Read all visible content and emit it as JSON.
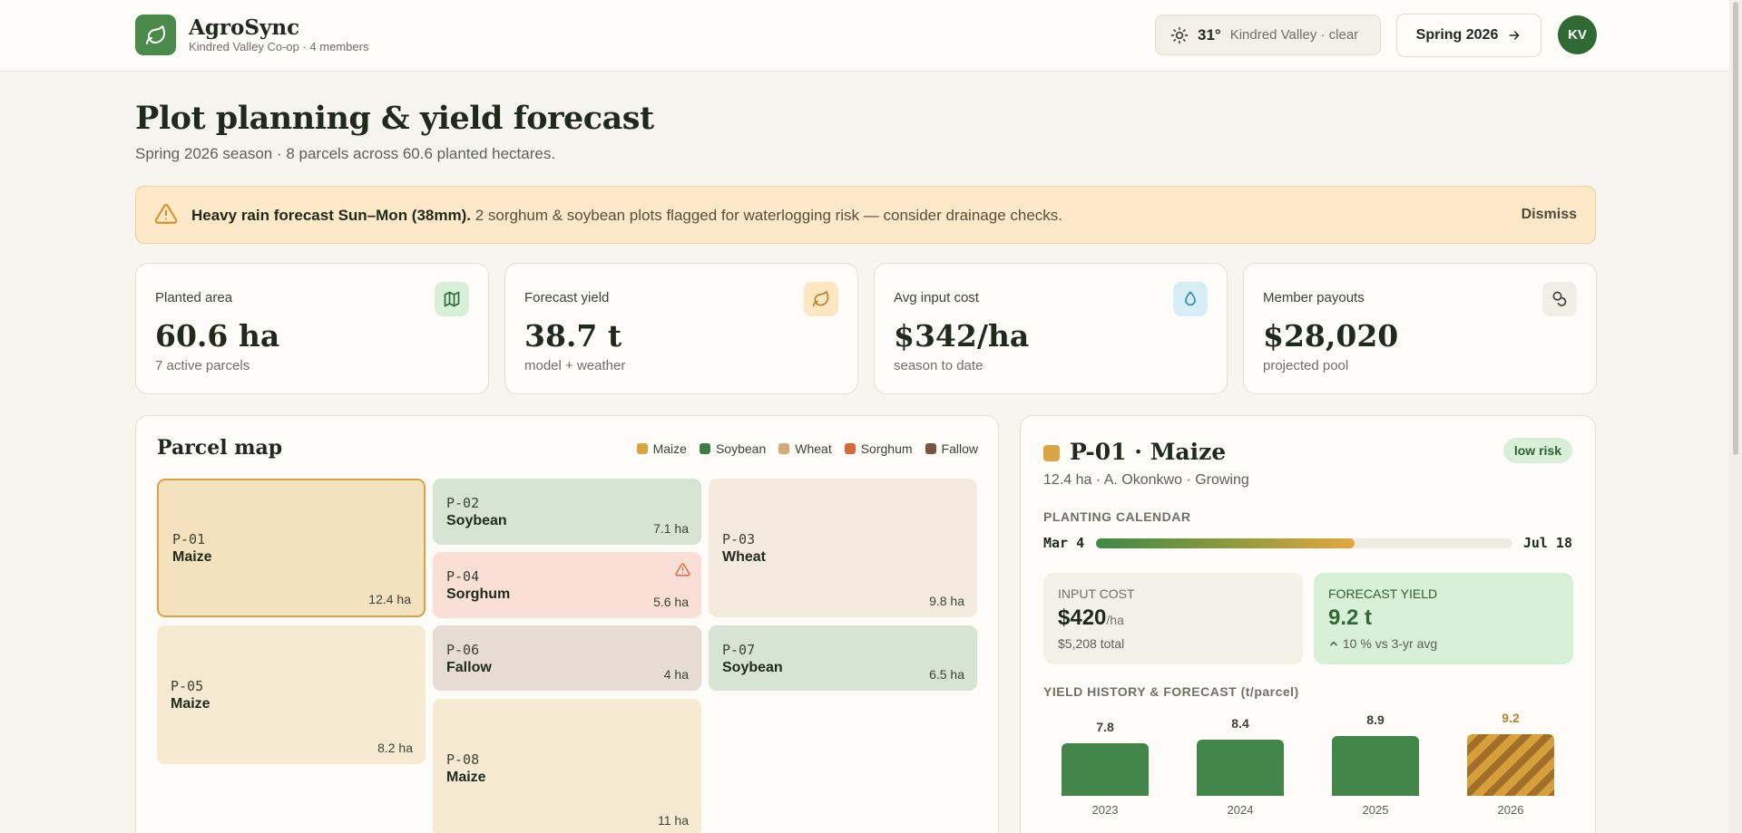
{
  "header": {
    "brand": "AgroSync",
    "org": "Kindred Valley Co-op · 4 members",
    "weather": {
      "temp": "31°",
      "location": "Kindred Valley · clear"
    },
    "season_button": "Spring 2026",
    "avatar_initials": "KV"
  },
  "page": {
    "title": "Plot planning & yield forecast",
    "subtitle": "Spring 2026 season · 8 parcels across 60.6 planted hectares."
  },
  "alert": {
    "headline": "Heavy rain forecast Sun–Mon (38mm).",
    "body": " 2 sorghum & soybean plots flagged for waterlogging risk — consider drainage checks.",
    "dismiss": "Dismiss"
  },
  "kpis": [
    {
      "label": "Planted area",
      "value": "60.6 ha",
      "sub": "7 active parcels",
      "icon": "map-icon"
    },
    {
      "label": "Forecast yield",
      "value": "38.7 t",
      "sub": "model + weather",
      "icon": "leaf-icon"
    },
    {
      "label": "Avg input cost",
      "value": "$342/ha",
      "sub": "season to date",
      "icon": "droplet-icon"
    },
    {
      "label": "Member payouts",
      "value": "$28,020",
      "sub": "projected pool",
      "icon": "coins-icon"
    }
  ],
  "map": {
    "title": "Parcel map",
    "legend": [
      {
        "name": "Maize",
        "color": "#d9a441"
      },
      {
        "name": "Soybean",
        "color": "#3f7d46"
      },
      {
        "name": "Wheat",
        "color": "#d3aa7a"
      },
      {
        "name": "Sorghum",
        "color": "#d9683a"
      },
      {
        "name": "Fallow",
        "color": "#7a5440"
      }
    ],
    "parcels": [
      {
        "id": "P-01",
        "crop": "Maize",
        "area": "12.4 ha"
      },
      {
        "id": "P-02",
        "crop": "Soybean",
        "area": "7.1 ha"
      },
      {
        "id": "P-03",
        "crop": "Wheat",
        "area": "9.8 ha"
      },
      {
        "id": "P-04",
        "crop": "Sorghum",
        "area": "5.6 ha"
      },
      {
        "id": "P-05",
        "crop": "Maize",
        "area": "8.2 ha"
      },
      {
        "id": "P-06",
        "crop": "Fallow",
        "area": "4 ha"
      },
      {
        "id": "P-07",
        "crop": "Soybean",
        "area": "6.5 ha"
      },
      {
        "id": "P-08",
        "crop": "Maize",
        "area": "11 ha"
      }
    ]
  },
  "detail": {
    "title": "P-01 · Maize",
    "risk": "low risk",
    "meta": "12.4 ha · A. Okonkwo · Growing",
    "calendar_label": "PLANTING CALENDAR",
    "calendar_start": "Mar 4",
    "calendar_end": "Jul 18",
    "calendar_progress": 0.62,
    "input_cost": {
      "label": "INPUT COST",
      "value": "$420",
      "unit": "/ha",
      "sub": "$5,208 total"
    },
    "forecast_yield": {
      "label": "FORECAST YIELD",
      "value": "9.2 t",
      "sub": "10 % vs 3-yr avg"
    },
    "history_label": "YIELD HISTORY & FORECAST (t/parcel)"
  },
  "chart_data": {
    "type": "bar",
    "categories": [
      "2023",
      "2024",
      "2025",
      "2026"
    ],
    "values": [
      7.8,
      8.4,
      8.9,
      9.2
    ],
    "forecast_index": 3,
    "ylabel": "t/parcel"
  }
}
